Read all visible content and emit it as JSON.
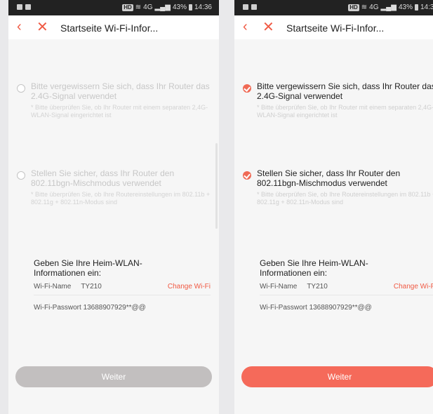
{
  "colors": {
    "accent": "#f05a44",
    "button_enabled": "#f56a5a",
    "button_disabled": "#c2bfbf",
    "statusbar": "#222222"
  },
  "status_bar": {
    "hd": "HD",
    "network": "4G",
    "battery_text": "43%",
    "time": "14:36"
  },
  "nav": {
    "back_icon": "chevron-left-icon",
    "close_icon": "close-icon",
    "title": "Startseite Wi-Fi-Infor..."
  },
  "checklist": {
    "item1_main": "Bitte vergewissern Sie sich, dass Ihr Router das 2.4G-Signal verwendet",
    "item1_sub": "* Bitte überprüfen Sie, ob Ihr Router mit einem separaten 2,4G-WLAN-Signal eingerichtet ist",
    "item2_main": "Stellen Sie sicher, dass Ihr Router den 802.11bgn-Mischmodus verwendet",
    "item2_sub": "* Bitte überprüfen Sie, ob Ihre Routereinstellungen im 802.11b + 802.11g + 802.11n-Modus sind"
  },
  "wifi": {
    "heading": "Geben Sie Ihre Heim-WLAN-Informationen ein:",
    "name_label": "Wi-Fi-Name",
    "name_value": "TY210",
    "change_label": "Change Wi-Fi",
    "password_label": "Wi-Fi-Passwort",
    "password_value": "13688907929**@@"
  },
  "screens": [
    {
      "state": "unchecked",
      "button_state": "disabled"
    },
    {
      "state": "checked",
      "button_state": "enabled"
    }
  ],
  "button": {
    "label": "Weiter"
  }
}
